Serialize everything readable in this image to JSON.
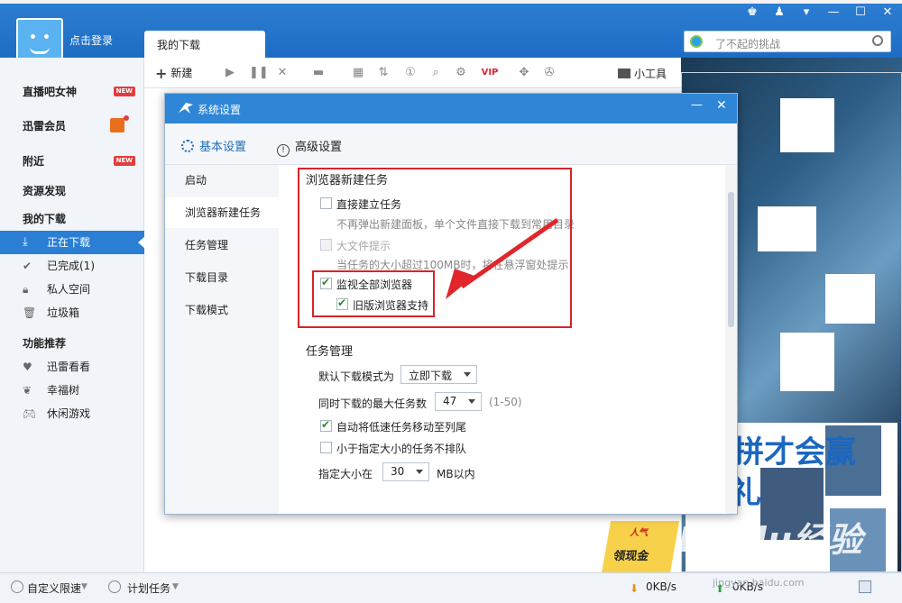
{
  "app": {
    "login_label": "点击登录",
    "tab_label": "我的下载",
    "search_placeholder": "了不起的挑战"
  },
  "sidebar": {
    "items": [
      {
        "label": "直播吧女神",
        "badge": "NEW"
      },
      {
        "label": "迅雷会员"
      },
      {
        "label": "附近",
        "badge": "NEW"
      },
      {
        "label": "资源发现"
      },
      {
        "label": "我的下载"
      },
      {
        "label": "正在下载"
      },
      {
        "label": "已完成(1)"
      },
      {
        "label": "私人空间"
      },
      {
        "label": "垃圾箱"
      },
      {
        "label": "功能推荐"
      },
      {
        "label": "迅雷看看"
      },
      {
        "label": "幸福树"
      },
      {
        "label": "休闲游戏"
      }
    ]
  },
  "toolbar": {
    "new_label": "新建",
    "tools_label": "小工具"
  },
  "dialog": {
    "title": "系统设置",
    "tabs": [
      "基本设置",
      "高级设置"
    ],
    "nav": [
      "启动",
      "浏览器新建任务",
      "任务管理",
      "下载目录",
      "下载模式"
    ],
    "browser_section": {
      "title": "浏览器新建任务",
      "direct_create": "直接建立任务",
      "direct_create_desc": "不再弹出新建面板，单个文件直接下载到常用目录",
      "big_file_hint": "大文件提示",
      "big_file_desc": "当任务的大小超过100MB时，将在悬浮窗处提示",
      "monitor_all": "监视全部浏览器",
      "legacy_support": "旧版浏览器支持"
    },
    "task_section": {
      "title": "任务管理",
      "default_mode_label": "默认下载模式为",
      "default_mode_value": "立即下载",
      "max_tasks_label": "同时下载的最大任务数",
      "max_tasks_value": "47",
      "max_tasks_range": "(1-50)",
      "auto_move": "自动将低速任务移动至列尾",
      "no_queue_small": "小于指定大小的任务不排队",
      "size_label": "指定大小在",
      "size_value": "30",
      "size_unit": "MB以内"
    }
  },
  "ad": {
    "slogan_line1": "拼才会赢",
    "slogan_line2": "礼",
    "promo_text": "领现金",
    "promo_top": "人气"
  },
  "statusbar": {
    "speed_mode": "自定义限速",
    "plan_task": "计划任务",
    "down_speed": "0KB/s",
    "up_speed": "0KB/s"
  },
  "watermark": {
    "brand": "Baidu经验",
    "url": "jingyan.baidu.com"
  }
}
